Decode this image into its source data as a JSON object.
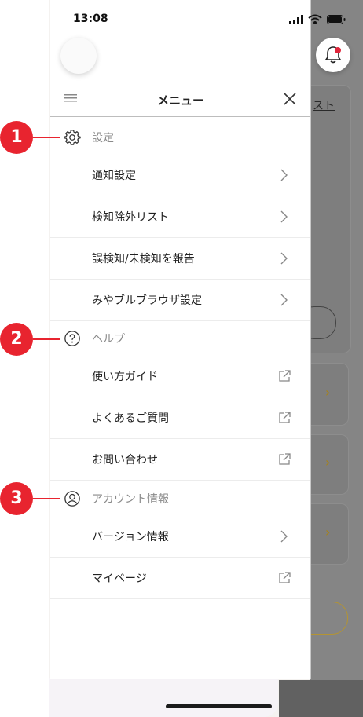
{
  "status_bar": {
    "time": "13:08"
  },
  "header": {
    "title": "メニュー"
  },
  "sections": [
    {
      "label": "設定",
      "icon": "gear-icon",
      "badge": "1",
      "items": [
        {
          "label": "通知設定",
          "icon": "chevron-right-icon"
        },
        {
          "label": "検知除外リスト",
          "icon": "chevron-right-icon"
        },
        {
          "label": "誤検知/未検知を報告",
          "icon": "chevron-right-icon"
        },
        {
          "label": "みやブルブラウザ設定",
          "icon": "chevron-right-icon"
        }
      ]
    },
    {
      "label": "ヘルプ",
      "icon": "help-circle-icon",
      "badge": "2",
      "items": [
        {
          "label": "使い方ガイド",
          "icon": "external-link-icon"
        },
        {
          "label": "よくあるご質問",
          "icon": "external-link-icon"
        },
        {
          "label": "お問い合わせ",
          "icon": "external-link-icon"
        }
      ]
    },
    {
      "label": "アカウント情報",
      "icon": "user-circle-icon",
      "badge": "3",
      "items": [
        {
          "label": "バージョン情報",
          "icon": "chevron-right-icon"
        },
        {
          "label": "マイページ",
          "icon": "external-link-icon"
        }
      ]
    }
  ],
  "background": {
    "partial_text": "スト"
  },
  "colors": {
    "badge": "#e8242f",
    "accent_chevron": "#a88214",
    "notification_dot": "#e0263b"
  }
}
